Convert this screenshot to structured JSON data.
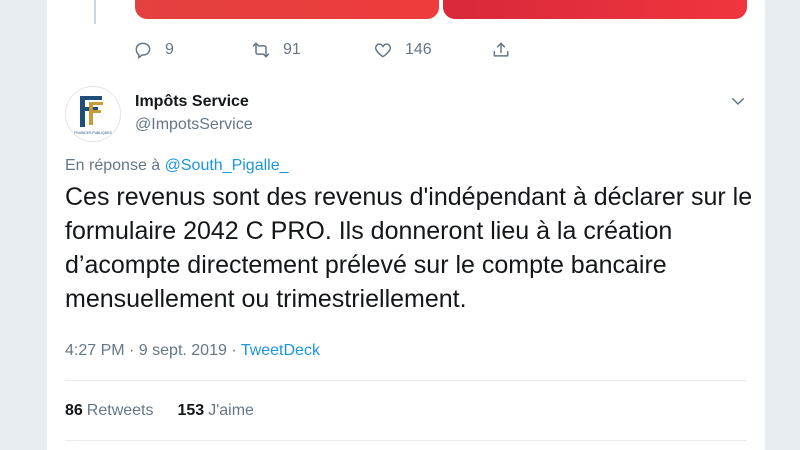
{
  "previous_tweet": {
    "actions": {
      "reply_count": "9",
      "retweet_count": "91",
      "like_count": "146"
    }
  },
  "tweet": {
    "author_name": "Impôts Service",
    "author_handle": "@ImpotsService",
    "reply_prefix": "En réponse à ",
    "reply_mention": "@South_Pigalle_",
    "text": "Ces revenus sont des revenus d'indépendant à déclarer sur le formulaire 2042 C PRO. Ils donneront lieu à la création d’acompte directement prélevé sur le compte bancaire mensuellement ou trimestriellement.",
    "timestamp": "4:27 PM · 9 sept. 2019 · ",
    "source": "TweetDeck",
    "retweets_count": "86",
    "retweets_label": "Retweets",
    "likes_count": "153",
    "likes_label": "J'aime"
  },
  "avatar": {
    "caption": "FINANCES PUBLIQUES"
  },
  "colors": {
    "link": "#1b95e0",
    "muted": "#657786",
    "text": "#14171a",
    "background": "#e6ecf0"
  },
  "icons": [
    "reply-icon",
    "retweet-icon",
    "like-icon",
    "share-icon",
    "chevron-down-icon"
  ]
}
